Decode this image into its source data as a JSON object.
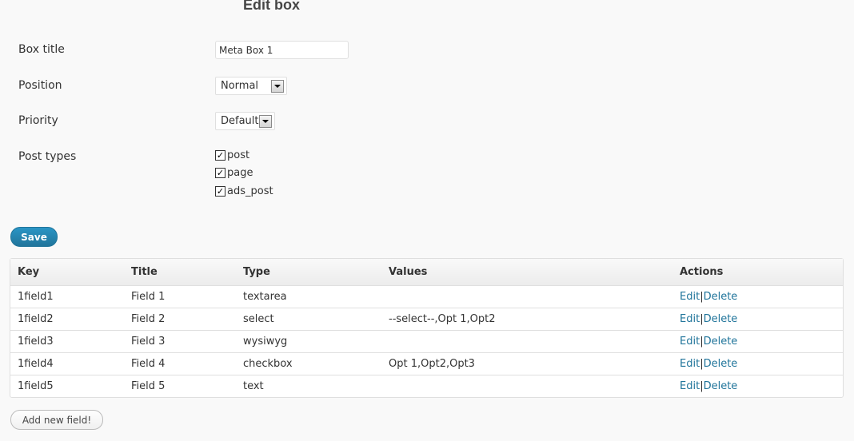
{
  "page": {
    "title": "Edit box"
  },
  "form": {
    "box_title": {
      "label": "Box title",
      "value": "Meta Box 1"
    },
    "position": {
      "label": "Position",
      "value": "Normal"
    },
    "priority": {
      "label": "Priority",
      "value": "Default"
    },
    "post_types": {
      "label": "Post types",
      "options": [
        {
          "label": "post",
          "checked": true
        },
        {
          "label": "page",
          "checked": true
        },
        {
          "label": "ads_post",
          "checked": true
        }
      ]
    },
    "save_label": "Save"
  },
  "table": {
    "headers": [
      "Key",
      "Title",
      "Type",
      "Values",
      "Actions"
    ],
    "rows": [
      {
        "key": "1field1",
        "title": "Field 1",
        "type": "textarea",
        "values": "",
        "edit": "Edit",
        "sep": "|",
        "delete": "Delete"
      },
      {
        "key": "1field2",
        "title": "Field 2",
        "type": "select",
        "values": "--select--,Opt 1,Opt2",
        "edit": "Edit",
        "sep": "|",
        "delete": "Delete"
      },
      {
        "key": "1field3",
        "title": "Field 3",
        "type": "wysiwyg",
        "values": "",
        "edit": "Edit",
        "sep": "|",
        "delete": "Delete"
      },
      {
        "key": "1field4",
        "title": "Field 4",
        "type": "checkbox",
        "values": "Opt 1,Opt2,Opt3",
        "edit": "Edit",
        "sep": "|",
        "delete": "Delete"
      },
      {
        "key": "1field5",
        "title": "Field 5",
        "type": "text",
        "values": "",
        "edit": "Edit",
        "sep": "|",
        "delete": "Delete"
      }
    ]
  },
  "add_field_label": "Add new field!",
  "colors": {
    "link": "#21759b",
    "primary_button": "#21759b",
    "background": "#f9f9f9"
  }
}
